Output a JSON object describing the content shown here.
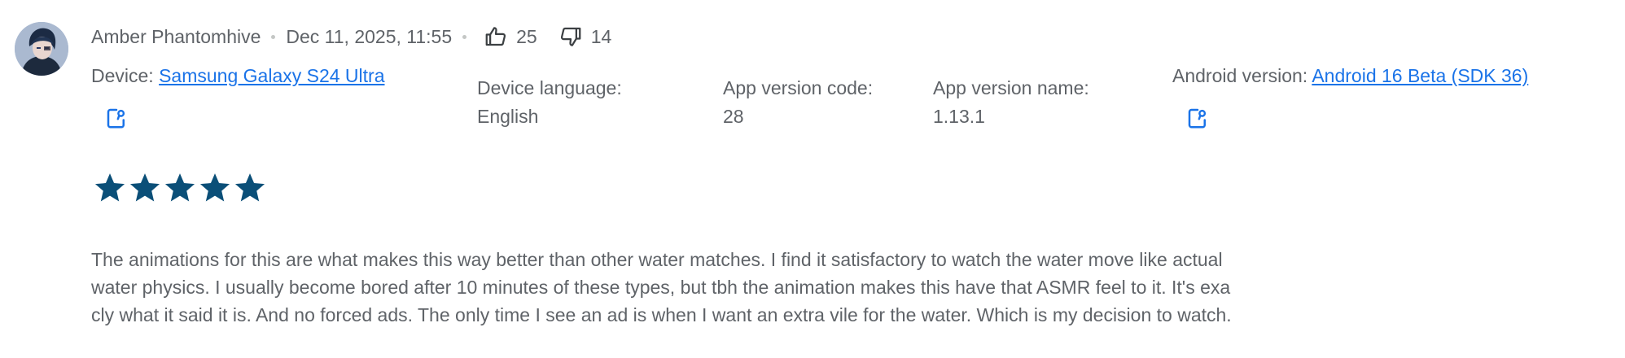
{
  "review": {
    "author": "Amber Phantomhive",
    "date": "Dec 11, 2025, 11:55",
    "thumbs_up_count": "25",
    "thumbs_down_count": "14",
    "rating": 5,
    "text_lines": [
      "The animations for this are what makes this way better than other water matches. I find it satisfactory to watch the water move like actual",
      "water physics. I usually become bored after 10 minutes of these types, but tbh the animation makes this have that ASMR feel to it. It's exa",
      "cly what it said it is. And no forced ads. The only time I see an ad is when I want an extra vile for the water. Which is my decision to watch."
    ]
  },
  "device_info": {
    "device_label": "Device:",
    "device_value": "Samsung Galaxy S24 Ultra",
    "language_label": "Device language:",
    "language_value": "English",
    "version_code_label": "App version code:",
    "version_code_value": "28",
    "version_name_label": "App version name:",
    "version_name_value": "1.13.1",
    "android_label": "Android version:",
    "android_value": "Android 16 Beta (SDK 36)"
  },
  "icons": {
    "thumbs_up": "thumbs-up-icon",
    "thumbs_down": "thumbs-down-icon",
    "copy": "copy-icon",
    "star": "star-icon"
  },
  "colors": {
    "star": "#0b4f78",
    "link": "#1a73e8",
    "text": "#5f6368"
  }
}
